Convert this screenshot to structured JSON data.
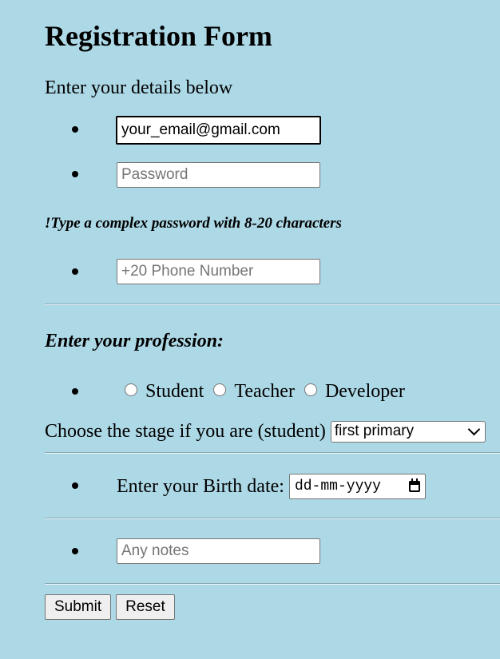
{
  "form": {
    "title": "Registration Form",
    "intro": "Enter your details below",
    "email": {
      "value": "your_email@gmail.com",
      "placeholder": ""
    },
    "password": {
      "value": "",
      "placeholder": "Password"
    },
    "password_hint": "!Type a complex password with 8-20 characters",
    "phone": {
      "value": "",
      "placeholder": "+20 Phone Number"
    },
    "profession_title": "Enter your profession:",
    "professions": [
      "Student",
      "Teacher",
      "Developer"
    ],
    "stage_label": "Choose the stage if you are (student)",
    "stage_selected": "first primary",
    "birth_label": "Enter your Birth date:",
    "birth_placeholder": "dd-mm-yyyy",
    "notes": {
      "value": "",
      "placeholder": "Any notes"
    },
    "submit_label": "Submit",
    "reset_label": "Reset"
  },
  "icons": {
    "bullet": "bullet-dot-icon",
    "radio": "radio-unchecked-icon",
    "select": "chevron-down-icon",
    "date": "calendar-icon"
  },
  "colors": {
    "background": "#add8e6",
    "input_border": "#767676",
    "button_bg": "#efefef"
  }
}
